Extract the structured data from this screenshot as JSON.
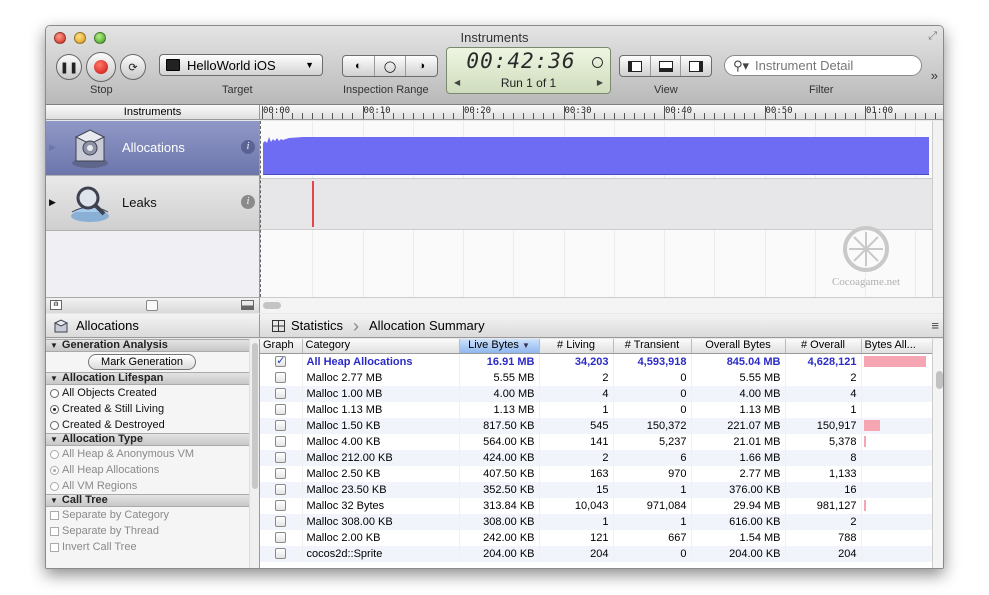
{
  "window": {
    "title": "Instruments"
  },
  "toolbar": {
    "stop_label": "Stop",
    "target_label": "Target",
    "target_value": "HelloWorld iOS",
    "inspection_label": "Inspection Range",
    "timer": "00:42:36",
    "run": "Run 1 of 1",
    "view_label": "View",
    "search_placeholder": "Instrument Detail",
    "filter_label": "Filter"
  },
  "instruments": {
    "header": "Instruments",
    "items": [
      {
        "name": "Allocations",
        "selected": true
      },
      {
        "name": "Leaks",
        "selected": false
      }
    ]
  },
  "ruler": {
    "ticks": [
      "00:00",
      "00:10",
      "00:20",
      "00:30",
      "00:40",
      "00:50",
      "01:00"
    ]
  },
  "watermark": "Cocoagame.net",
  "detail": {
    "left_title": "Allocations",
    "view_mode": "Statistics",
    "breadcrumb": "Allocation Summary"
  },
  "settings": {
    "generation_analysis": "Generation Analysis",
    "mark_generation": "Mark Generation",
    "allocation_lifespan": "Allocation Lifespan",
    "lifespan_options": [
      "All Objects Created",
      "Created & Still Living",
      "Created & Destroyed"
    ],
    "allocation_type": "Allocation Type",
    "type_options": [
      "All Heap & Anonymous VM",
      "All Heap Allocations",
      "All VM Regions"
    ],
    "call_tree": "Call Tree",
    "call_tree_options": [
      "Separate by Category",
      "Separate by Thread",
      "Invert Call Tree"
    ]
  },
  "table": {
    "columns": [
      "Graph",
      "Category",
      "Live Bytes",
      "# Living",
      "# Transient",
      "Overall Bytes",
      "# Overall",
      "Bytes All..."
    ],
    "rows": [
      {
        "checked": true,
        "category": "All Heap Allocations",
        "live": "16.91 MB",
        "living": "34,203",
        "transient": "4,593,918",
        "overall_bytes": "845.04 MB",
        "overall": "4,628,121",
        "bar": 1.0
      },
      {
        "checked": false,
        "category": "Malloc 2.77 MB",
        "live": "5.55 MB",
        "living": "2",
        "transient": "0",
        "overall_bytes": "5.55 MB",
        "overall": "2",
        "bar": 0
      },
      {
        "checked": false,
        "category": "Malloc 1.00 MB",
        "live": "4.00 MB",
        "living": "4",
        "transient": "0",
        "overall_bytes": "4.00 MB",
        "overall": "4",
        "bar": 0
      },
      {
        "checked": false,
        "category": "Malloc 1.13 MB",
        "live": "1.13 MB",
        "living": "1",
        "transient": "0",
        "overall_bytes": "1.13 MB",
        "overall": "1",
        "bar": 0
      },
      {
        "checked": false,
        "category": "Malloc 1.50 KB",
        "live": "817.50 KB",
        "living": "545",
        "transient": "150,372",
        "overall_bytes": "221.07 MB",
        "overall": "150,917",
        "bar": 0.26
      },
      {
        "checked": false,
        "category": "Malloc 4.00 KB",
        "live": "564.00 KB",
        "living": "141",
        "transient": "5,237",
        "overall_bytes": "21.01 MB",
        "overall": "5,378",
        "bar": 0.02
      },
      {
        "checked": false,
        "category": "Malloc 212.00 KB",
        "live": "424.00 KB",
        "living": "2",
        "transient": "6",
        "overall_bytes": "1.66 MB",
        "overall": "8",
        "bar": 0
      },
      {
        "checked": false,
        "category": "Malloc 2.50 KB",
        "live": "407.50 KB",
        "living": "163",
        "transient": "970",
        "overall_bytes": "2.77 MB",
        "overall": "1,133",
        "bar": 0
      },
      {
        "checked": false,
        "category": "Malloc 23.50 KB",
        "live": "352.50 KB",
        "living": "15",
        "transient": "1",
        "overall_bytes": "376.00 KB",
        "overall": "16",
        "bar": 0
      },
      {
        "checked": false,
        "category": "Malloc 32 Bytes",
        "live": "313.84 KB",
        "living": "10,043",
        "transient": "971,084",
        "overall_bytes": "29.94 MB",
        "overall": "981,127",
        "bar": 0.03
      },
      {
        "checked": false,
        "category": "Malloc 308.00 KB",
        "live": "308.00 KB",
        "living": "1",
        "transient": "1",
        "overall_bytes": "616.00 KB",
        "overall": "2",
        "bar": 0
      },
      {
        "checked": false,
        "category": "Malloc 2.00 KB",
        "live": "242.00 KB",
        "living": "121",
        "transient": "667",
        "overall_bytes": "1.54 MB",
        "overall": "788",
        "bar": 0
      },
      {
        "checked": false,
        "category": "cocos2d::Sprite",
        "live": "204.00 KB",
        "living": "204",
        "transient": "0",
        "overall_bytes": "204.00 KB",
        "overall": "204",
        "bar": 0
      }
    ]
  },
  "colors": {
    "allocations_track": "#6e6cf2",
    "leak_marker": "#e34848",
    "selected_row_text": "#2b2bc7",
    "bytes_bar": "#f6a5b2"
  }
}
